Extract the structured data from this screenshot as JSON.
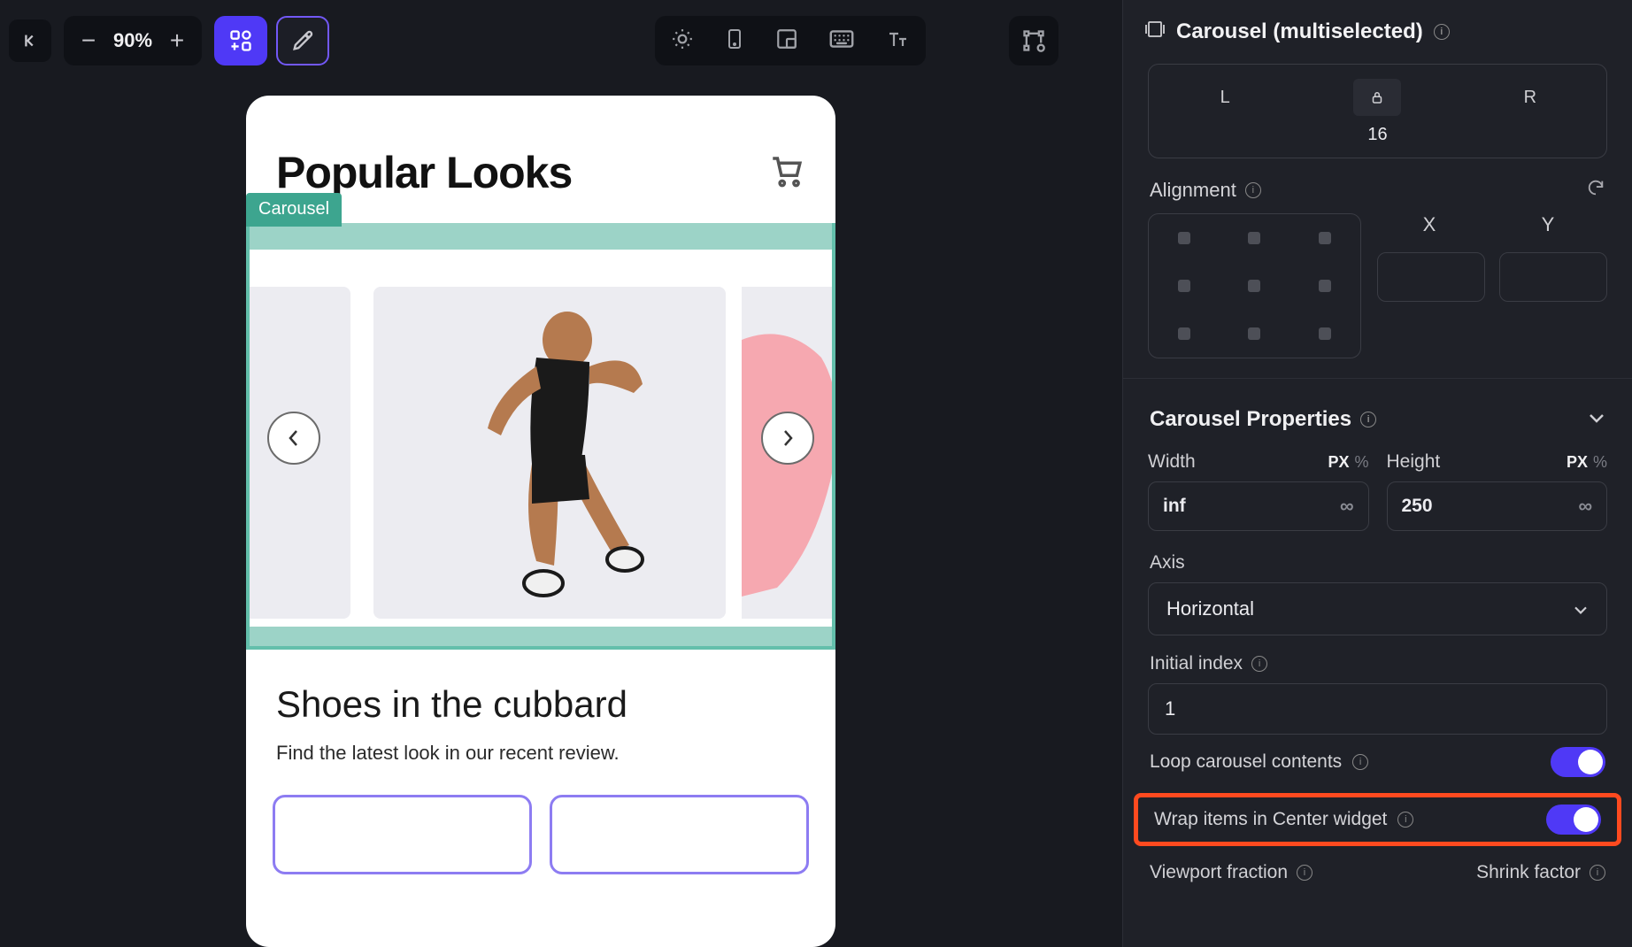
{
  "toolbar": {
    "zoom": "90%"
  },
  "canvas": {
    "title": "Popular Looks",
    "carousel_tag": "Carousel",
    "section_title": "Shoes in the cubbard",
    "section_sub": "Find the latest look in our recent review."
  },
  "panel": {
    "title": "Carousel (multiselected)",
    "lrr": {
      "l": "L",
      "r": "R",
      "value": "16"
    },
    "alignment_label": "Alignment",
    "xy": {
      "x_label": "X",
      "y_label": "Y"
    },
    "section_title": "Carousel Properties",
    "width": {
      "label": "Width",
      "unit_px": "PX",
      "unit_pct": "%",
      "value": "inf"
    },
    "height": {
      "label": "Height",
      "unit_px": "PX",
      "unit_pct": "%",
      "value": "250"
    },
    "axis": {
      "label": "Axis",
      "value": "Horizontal"
    },
    "initial_index": {
      "label": "Initial index",
      "value": "1"
    },
    "loop_label": "Loop carousel contents",
    "wrap_label": "Wrap items in Center widget",
    "viewport_label": "Viewport fraction",
    "shrink_label": "Shrink factor"
  }
}
